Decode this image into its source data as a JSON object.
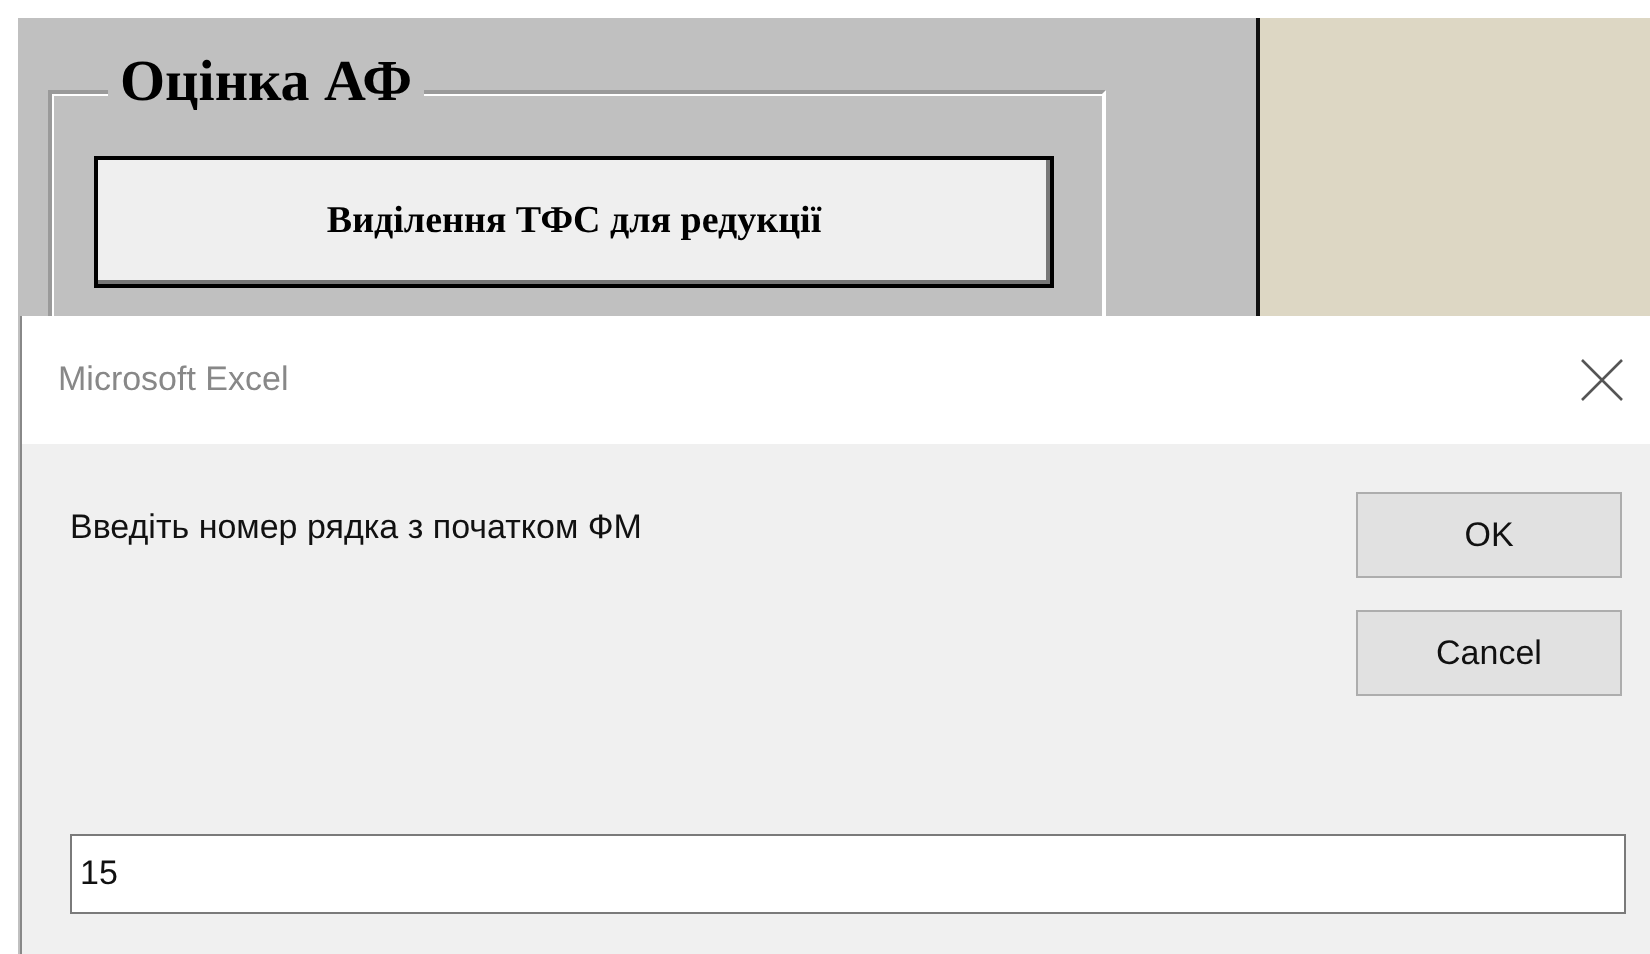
{
  "background": {
    "group_title": "Оцінка АФ",
    "button": "Виділення ТФС для редукції"
  },
  "dialog": {
    "title": "Microsoft Excel",
    "prompt": "Введіть номер рядка з початком ФМ",
    "buttons": [
      "OK",
      "Cancel"
    ],
    "input_value": "15"
  }
}
